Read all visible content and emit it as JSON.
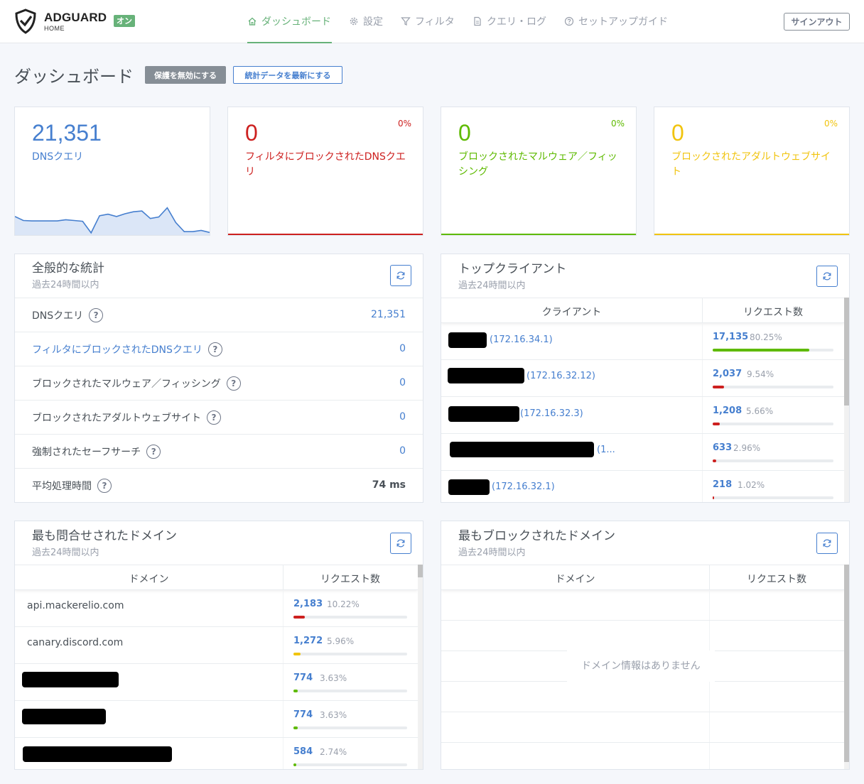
{
  "header": {
    "brand": "ADGUARD",
    "brand_sub": "HOME",
    "status_badge": "オン",
    "nav": [
      {
        "label": "ダッシュボード",
        "icon": "home-icon"
      },
      {
        "label": "設定",
        "icon": "gear-icon"
      },
      {
        "label": "フィルタ",
        "icon": "filter-icon"
      },
      {
        "label": "クエリ・ログ",
        "icon": "document-icon"
      },
      {
        "label": "セットアップガイド",
        "icon": "help-circle-icon"
      }
    ],
    "signout": "サインアウト"
  },
  "page": {
    "title": "ダッシュボード",
    "disable_protection": "保護を無効にする",
    "refresh_stats": "統計データを最新にする"
  },
  "stat_cards": [
    {
      "value": "21,351",
      "label": "DNSクエリ",
      "percent": "",
      "color": "#467fcf"
    },
    {
      "value": "0",
      "label": "フィルタにブロックされたDNSクエリ",
      "percent": "0%",
      "color": "#cd201f"
    },
    {
      "value": "0",
      "label": "ブロックされたマルウェア／フィッシング",
      "percent": "0%",
      "color": "#5eba00"
    },
    {
      "value": "0",
      "label": "ブロックされたアダルトウェブサイト",
      "percent": "0%",
      "color": "#f1c40f"
    }
  ],
  "sparkline": {
    "values": [
      0.43,
      0.33,
      0.32,
      0.32,
      0.32,
      0.32,
      0.35,
      0.33,
      0.31,
      0.02,
      0.45,
      0.49,
      0.43,
      0.5,
      0.55,
      0.57,
      0.38,
      0.42,
      0.65,
      0.28,
      0.05,
      0.05,
      0.08,
      0.03
    ],
    "color": "#467fcf"
  },
  "general_stats": {
    "title": "全般的な統計",
    "subtitle": "過去24時間以内",
    "rows": [
      {
        "label": "DNSクエリ",
        "value": "21,351",
        "link": false
      },
      {
        "label": "フィルタにブロックされたDNSクエリ",
        "value": "0",
        "link": true
      },
      {
        "label": "ブロックされたマルウェア／フィッシング",
        "value": "0",
        "link": false
      },
      {
        "label": "ブロックされたアダルトウェブサイト",
        "value": "0",
        "link": false
      },
      {
        "label": "強制されたセーフサーチ",
        "value": "0",
        "link": false
      },
      {
        "label": "平均処理時間",
        "value": "74 ms",
        "link": false
      }
    ],
    "help_mark": "?"
  },
  "top_clients": {
    "title": "トップクライアント",
    "subtitle": "過去24時間以内",
    "col_client": "クライアント",
    "col_requests": "リクエスト数",
    "rows": [
      {
        "ip": "(172.16.34.1)",
        "count": "17,135",
        "percent": "80.25%",
        "fraction": 0.8025,
        "color": "#5eba00"
      },
      {
        "ip": "(172.16.32.12)",
        "count": "2,037",
        "percent": "9.54%",
        "fraction": 0.0954,
        "color": "#cd201f"
      },
      {
        "ip": "(172.16.32.3)",
        "count": "1,208",
        "percent": "5.66%",
        "fraction": 0.0566,
        "color": "#cd201f"
      },
      {
        "ip": "(1...",
        "count": "633",
        "percent": "2.96%",
        "fraction": 0.0296,
        "color": "#cd201f"
      },
      {
        "ip": "(172.16.32.1)",
        "count": "218",
        "percent": "1.02%",
        "fraction": 0.0102,
        "color": "#cd201f"
      }
    ]
  },
  "top_queried": {
    "title": "最も問合せされたドメイン",
    "subtitle": "過去24時間以内",
    "col_domain": "ドメイン",
    "col_requests": "リクエスト数",
    "rows": [
      {
        "domain": "api.mackerelio.com",
        "count": "2,183",
        "percent": "10.22%",
        "fraction": 0.1022,
        "color": "#cd201f"
      },
      {
        "domain": "canary.discord.com",
        "count": "1,272",
        "percent": "5.96%",
        "fraction": 0.0596,
        "color": "#f1c40f"
      },
      {
        "domain": "",
        "count": "774",
        "percent": "3.63%",
        "fraction": 0.0363,
        "color": "#5eba00"
      },
      {
        "domain": "",
        "count": "774",
        "percent": "3.63%",
        "fraction": 0.0363,
        "color": "#5eba00"
      },
      {
        "domain": "",
        "count": "584",
        "percent": "2.74%",
        "fraction": 0.0274,
        "color": "#5eba00"
      }
    ]
  },
  "top_blocked": {
    "title": "最もブロックされたドメイン",
    "subtitle": "過去24時間以内",
    "col_domain": "ドメイン",
    "col_requests": "リクエスト数",
    "empty_text": "ドメイン情報はありません"
  }
}
